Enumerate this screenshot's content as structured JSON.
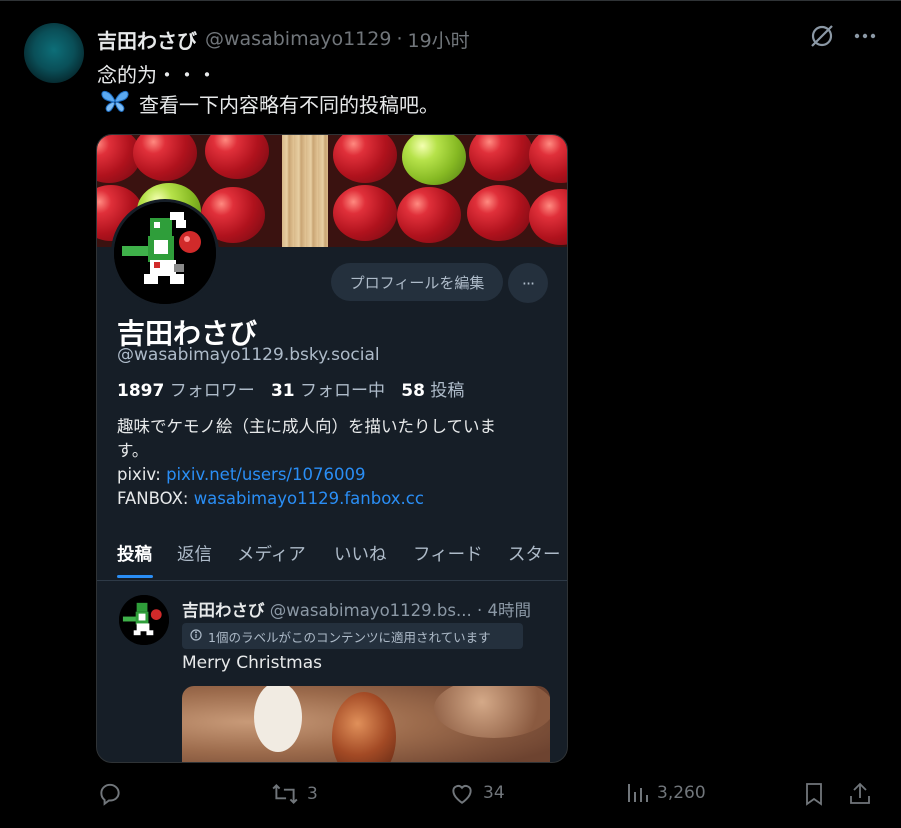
{
  "tweet": {
    "display_name": "吉田わさび",
    "handle": "@wasabimayo1129",
    "separator": "·",
    "time": "19小时",
    "text_line1": "念的为・・・",
    "text_line2": "查看一下内容略有不同的投稿吧。",
    "butterfly_icon": "butterfly-icon"
  },
  "card": {
    "edit_profile": "プロフィールを編集",
    "more": "···",
    "name": "吉田わさび",
    "handle": "@wasabimayo1129.bsky.social",
    "followers_count": "1897",
    "followers_label": "フォロワー",
    "following_count": "31",
    "following_label": "フォロー中",
    "posts_count": "58",
    "posts_label": "投稿",
    "bio_line1": "趣味でケモノ絵（主に成人向）を描いたりしていま",
    "bio_line2": "す。",
    "pixiv_label": "pixiv: ",
    "pixiv_link": "pixiv.net/users/1076009",
    "fanbox_label": "FANBOX: ",
    "fanbox_link": "wasabimayo1129.fanbox.cc",
    "tabs": [
      "投稿",
      "返信",
      "メディア",
      "いいね",
      "フィード",
      "スター"
    ],
    "post": {
      "name": "吉田わさび",
      "handle": "@wasabimayo1129.bs...",
      "time": "· 4時間",
      "label": "1個のラベルがこのコンテンツに適用されています",
      "text": "Merry Christmas"
    }
  },
  "actions": {
    "replies": "",
    "reposts": "3",
    "likes": "34",
    "views": "3,260"
  },
  "colors": {
    "background": "#000000",
    "card_bg": "#161e27",
    "link": "#2a8ef5",
    "muted": "#71767b"
  }
}
